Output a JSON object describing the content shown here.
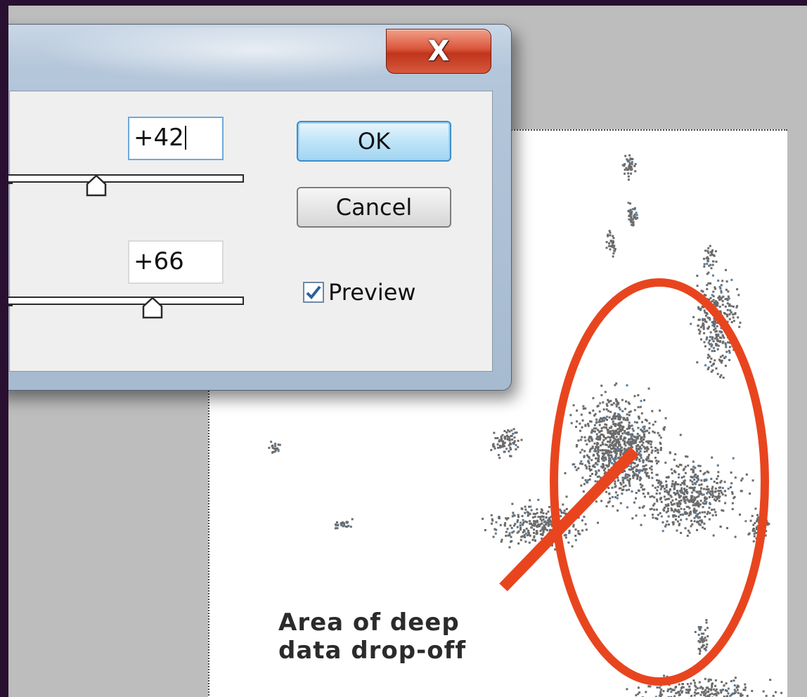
{
  "dialog": {
    "close_label": "X",
    "field1": {
      "value": "+42",
      "slider_level_percent": 44
    },
    "field2": {
      "value": "+66",
      "slider_level_percent": 67
    },
    "ok_label": "OK",
    "cancel_label": "Cancel",
    "preview_label": "Preview",
    "preview_checked": true
  },
  "annotation": {
    "text": "Area of deep\ndata drop-off",
    "color": "#e8451f"
  },
  "colors": {
    "background": "#2a1030",
    "workspace": "#bdbdbd",
    "ok_border": "#3b8fcb",
    "close_red": "#c0341c"
  }
}
